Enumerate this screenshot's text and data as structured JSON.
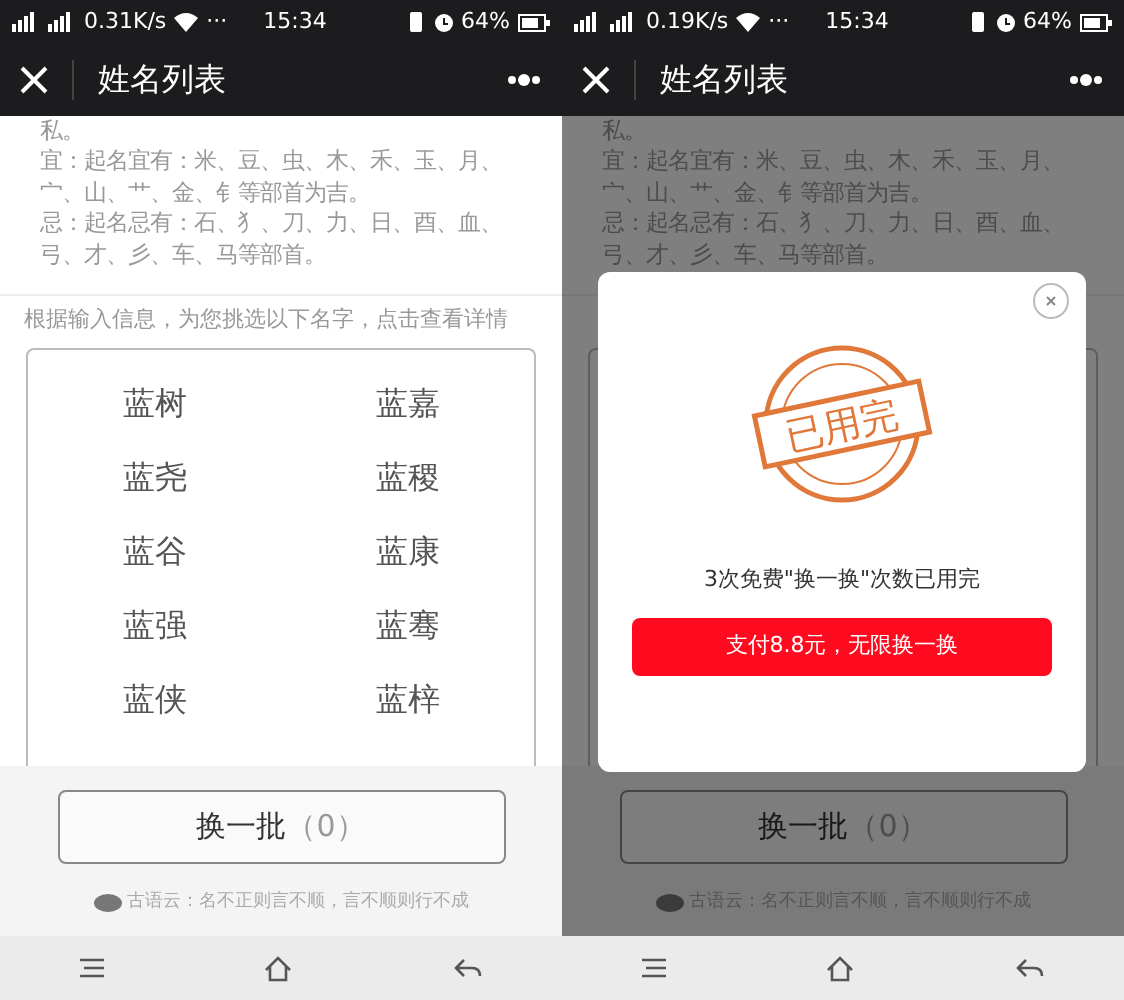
{
  "screens": [
    {
      "status_bar": {
        "speed": "0.31K/s",
        "dots": "···",
        "time": "15:34",
        "battery": "64%"
      },
      "title": "姓名列表",
      "lines": [
        "私。",
        "宜：起名宜有：米、豆、虫、木、禾、玉、月、",
        "宀、山、艹、金、钅等部首为吉。",
        "忌：起名忌有：石、犭、刀、力、日、酉、血、",
        "弓、才、彡、车、马等部首。"
      ],
      "hint": "根据输入信息，为您挑选以下名字，点击查看详情",
      "names": [
        "蓝树",
        "蓝嘉",
        "蓝尧",
        "蓝稷",
        "蓝谷",
        "蓝康",
        "蓝强",
        "蓝骞",
        "蓝侠",
        "蓝梓"
      ],
      "refresh_button": "换一批",
      "refresh_count": "（0）",
      "footer": "古语云：名不正则言不顺，言不顺则行不成"
    },
    {
      "status_bar": {
        "speed": "0.19K/s",
        "dots": "···",
        "time": "15:34",
        "battery": "64%"
      },
      "title": "姓名列表",
      "lines": [
        "私。",
        "宜：起名宜有：米、豆、虫、木、禾、玉、月、",
        "宀、山、艹、金、钅等部首为吉。",
        "忌：起名忌有：石、犭、刀、力、日、酉、血、",
        "弓、才、彡、车、马等部首。"
      ],
      "refresh_button": "换一批",
      "refresh_count": "（0）",
      "footer": "古语云：名不正则言不顺，言不顺则行不成",
      "modal": {
        "stamp": "已用完",
        "message": "3次免费\"换一换\"次数已用完",
        "pay_button": "支付8.8元，无限换一换"
      }
    }
  ]
}
